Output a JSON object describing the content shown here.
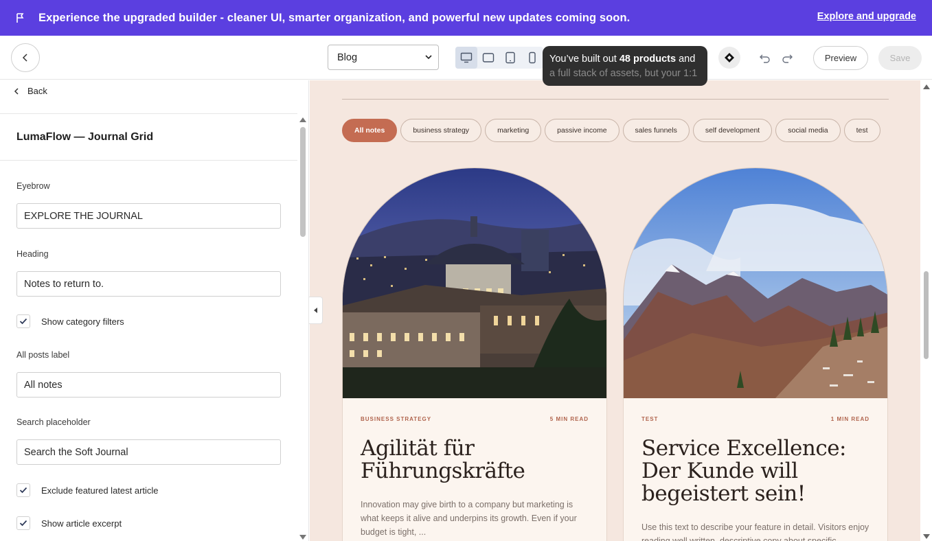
{
  "banner": {
    "message": "Experience the upgraded builder - cleaner UI, smarter organization, and powerful new updates coming soon.",
    "link": "Explore and upgrade",
    "icon": "flag-icon",
    "color": "#5b3fe0"
  },
  "toolbar": {
    "page_select": "Blog",
    "devices": [
      "desktop-icon",
      "tablet-landscape-icon",
      "tablet-portrait-icon",
      "mobile-icon"
    ],
    "active_device": "desktop",
    "tooltip_line1_prefix": "You’ve built out ",
    "tooltip_line1_bold": "48 products",
    "tooltip_line1_suffix": " and",
    "tooltip_line2": "a full stack of assets, but your 1:1",
    "preview_label": "Preview",
    "save_label": "Save"
  },
  "panel": {
    "back_label": "Back",
    "title": "LumaFlow — Journal Grid",
    "eyebrow_label": "Eyebrow",
    "eyebrow_value": "EXPLORE THE JOURNAL",
    "heading_label": "Heading",
    "heading_value": "Notes to return to.",
    "show_filters_label": "Show category filters",
    "show_filters_checked": true,
    "all_posts_label": "All posts label",
    "all_posts_value": "All notes",
    "search_label": "Search placeholder",
    "search_value": "Search the Soft Journal",
    "exclude_featured_label": "Exclude featured latest article",
    "exclude_featured_checked": true,
    "show_excerpt_label": "Show article excerpt",
    "show_excerpt_checked": true
  },
  "canvas": {
    "chips": [
      "All notes",
      "business strategy",
      "marketing",
      "passive income",
      "sales funnels",
      "self development",
      "social media",
      "test"
    ],
    "active_chip": "All notes",
    "accent": "#c46c52",
    "background": "#f5e7df",
    "cards": [
      {
        "category": "BUSINESS STRATEGY",
        "read_time": "5 MIN READ",
        "title": "Agilität für Führungskräfte",
        "excerpt": "Innovation may give birth to a company but marketing is what keeps it alive and underpins its growth. Even if your budget is tight, ..."
      },
      {
        "category": "TEST",
        "read_time": "1 MIN READ",
        "title": "Service Excellence: Der Kunde will begeistert sein!",
        "excerpt": "Use this text to describe your feature in detail. Visitors enjoy reading well written, descriptive copy about specific"
      }
    ]
  }
}
